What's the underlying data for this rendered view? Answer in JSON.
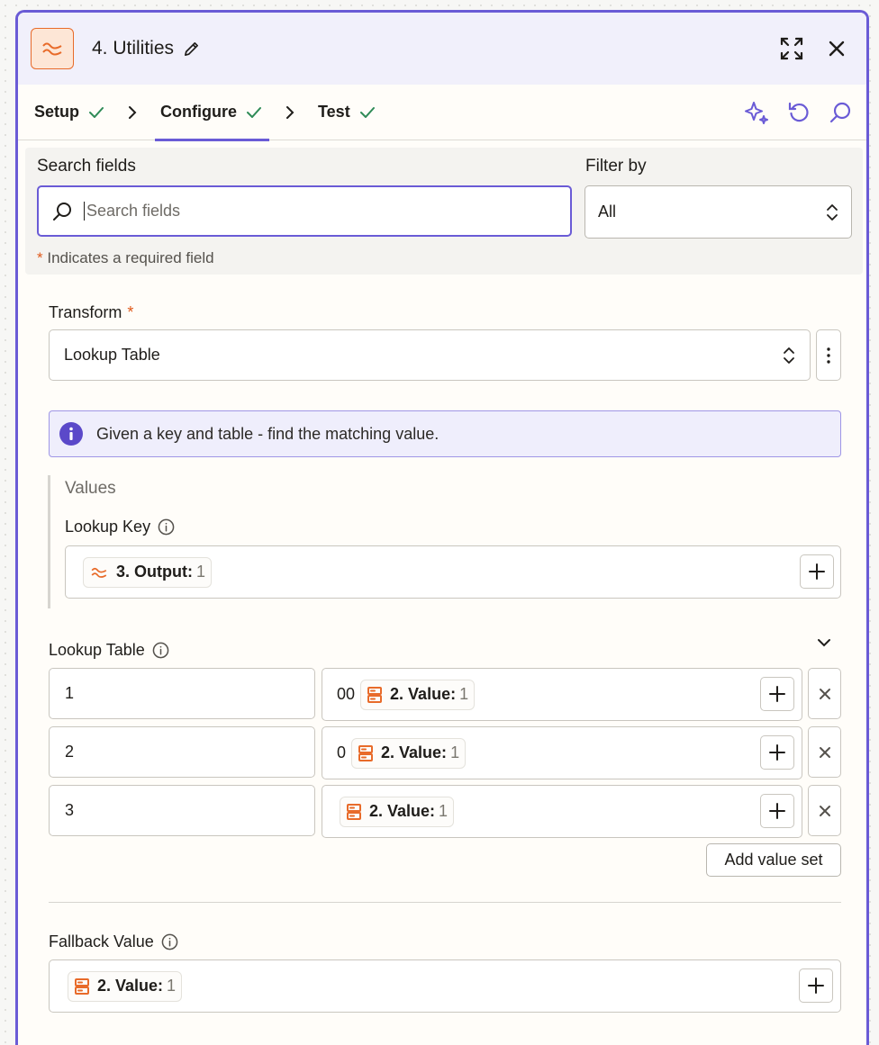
{
  "header": {
    "title": "4. Utilities"
  },
  "tabs": [
    {
      "label": "Setup"
    },
    {
      "label": "Configure"
    },
    {
      "label": "Test"
    }
  ],
  "search": {
    "label": "Search fields",
    "placeholder": "Search fields",
    "filter_label": "Filter by",
    "filter_value": "All",
    "required_note": "Indicates a required field",
    "required_star": "*"
  },
  "transform": {
    "label": "Transform",
    "star": "*",
    "value": "Lookup Table"
  },
  "info": {
    "text": "Given a key and table - find the matching value."
  },
  "values": {
    "title": "Values",
    "lookup_key_label": "Lookup Key",
    "lookup_key_pill": {
      "name": "3. Output:",
      "count": "1"
    }
  },
  "lookup_table": {
    "label": "Lookup Table",
    "rows": [
      {
        "key": "1",
        "prefix": "00",
        "pill_name": "2. Value:",
        "pill_count": "1"
      },
      {
        "key": "2",
        "prefix": "0",
        "pill_name": "2. Value:",
        "pill_count": "1"
      },
      {
        "key": "3",
        "prefix": "",
        "pill_name": "2. Value:",
        "pill_count": "1"
      }
    ],
    "add_label": "Add value set"
  },
  "fallback": {
    "label": "Fallback Value",
    "pill": {
      "name": "2. Value:",
      "count": "1"
    }
  },
  "colors": {
    "accent": "#6a5bd6",
    "brand_orange": "#e86b2a",
    "check_green": "#2e8b57"
  }
}
